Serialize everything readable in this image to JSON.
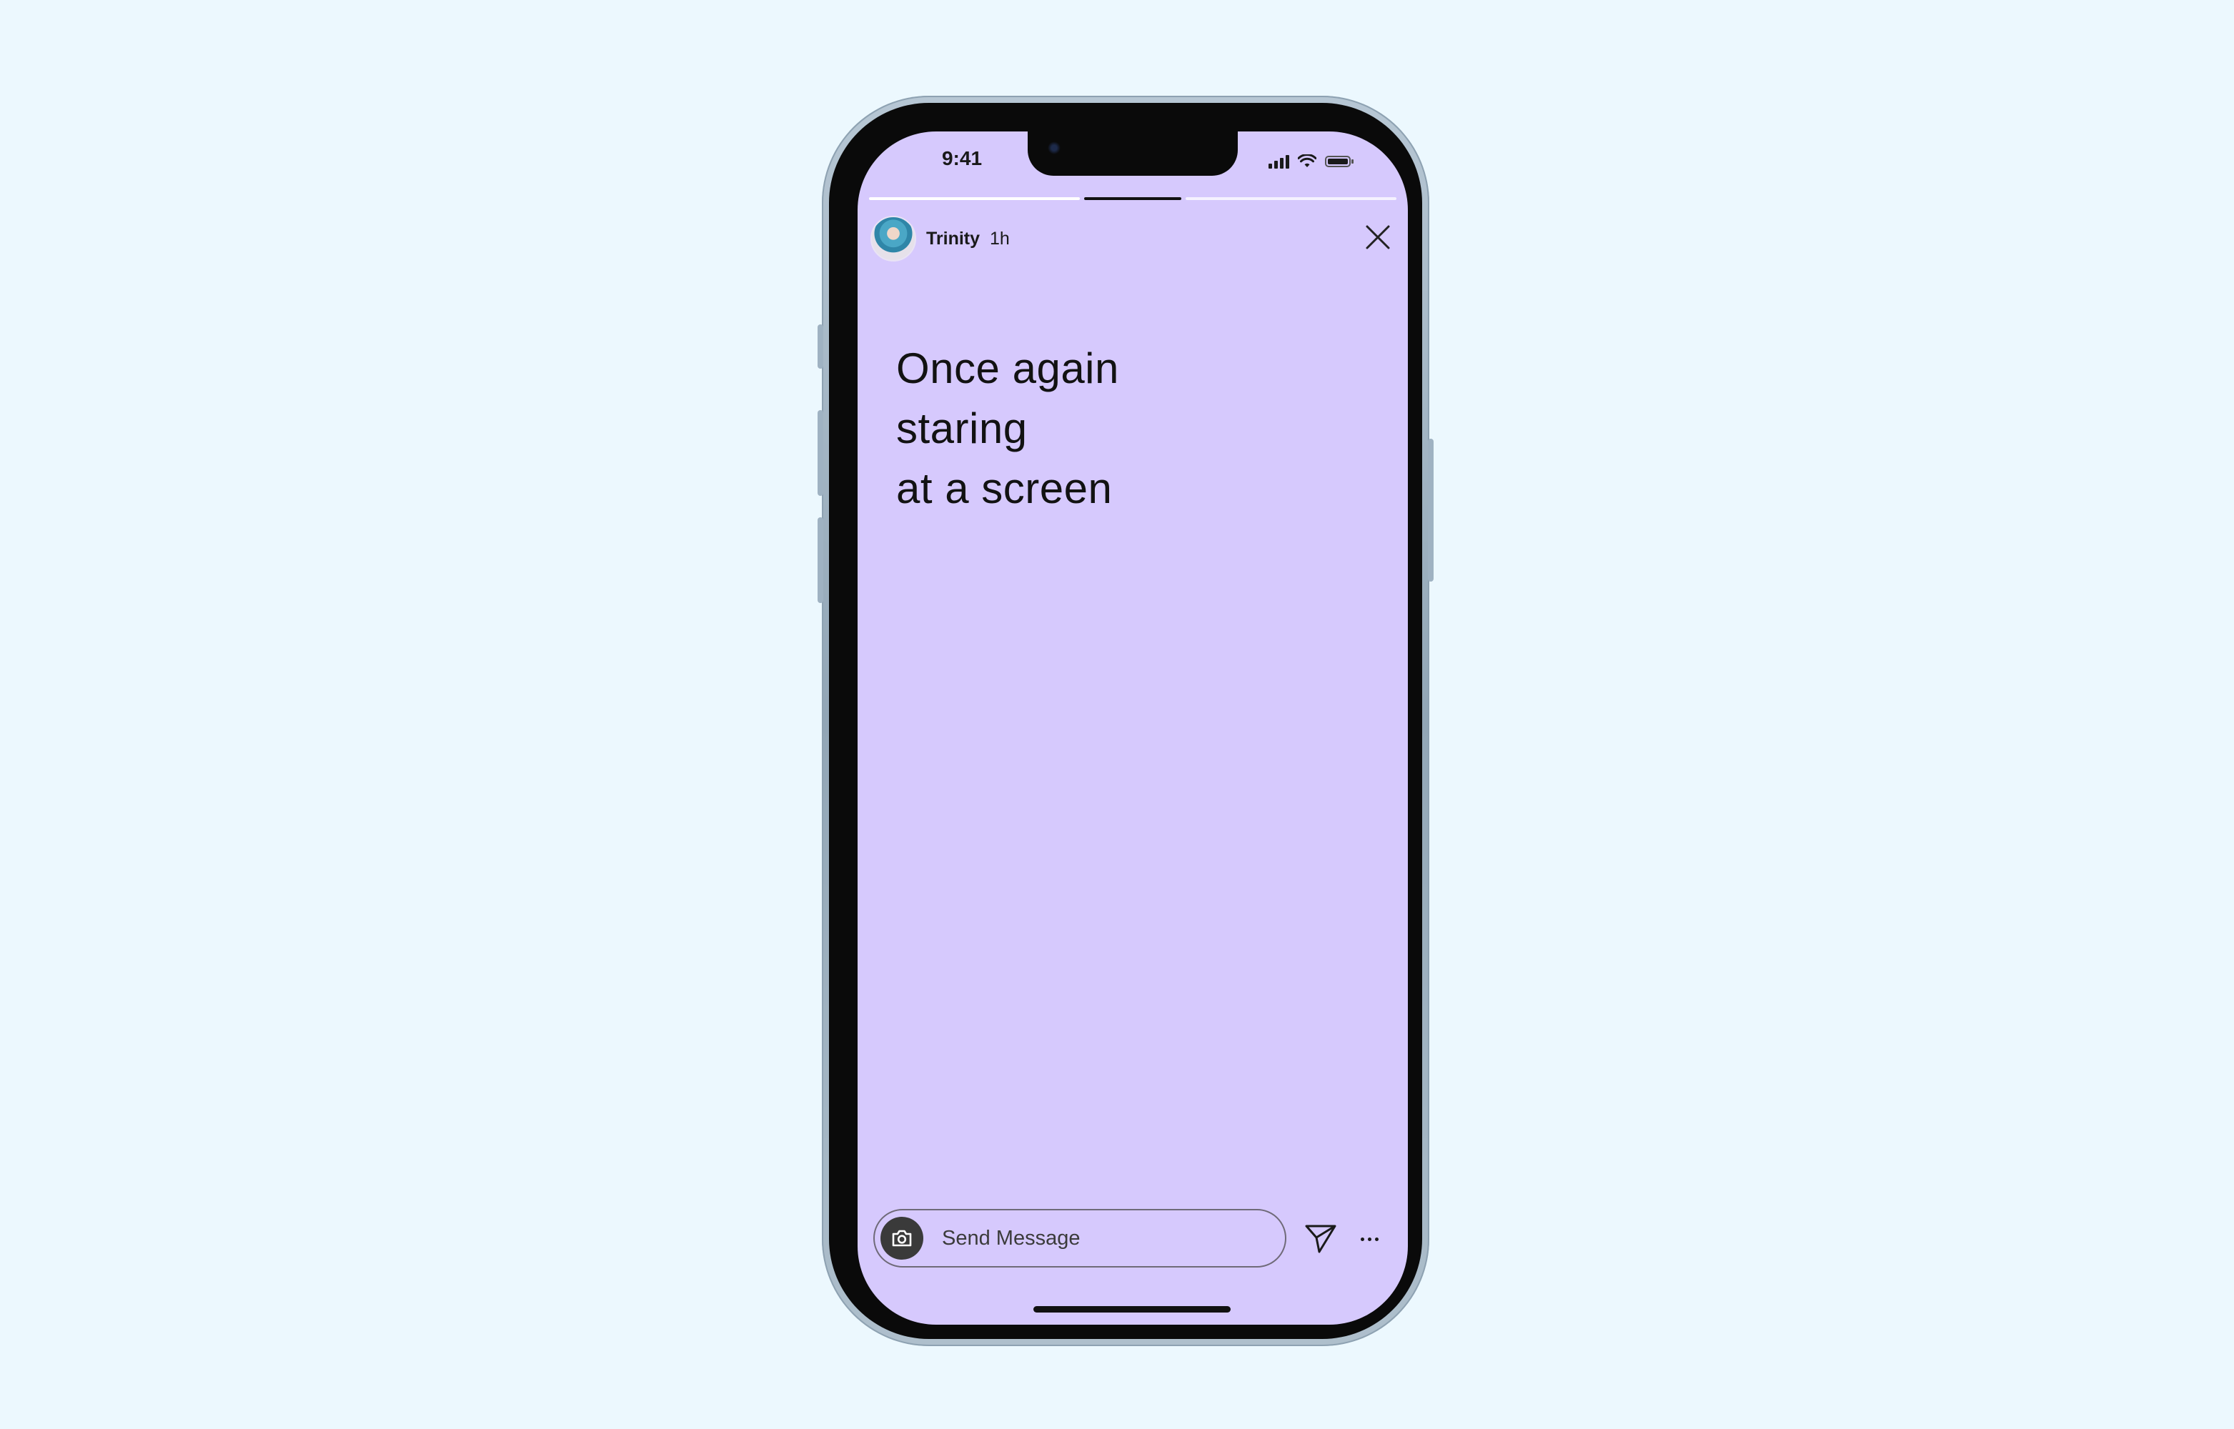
{
  "status_bar": {
    "time": "9:41",
    "icons": [
      "cellular-signal-icon",
      "wifi-icon",
      "battery-icon"
    ]
  },
  "story": {
    "segments_total": 3,
    "active_segment": 2,
    "active_progress": 1.0,
    "user": {
      "name": "Trinity",
      "time_ago": "1h",
      "avatar_icon": "user-avatar"
    },
    "text_lines": [
      "Once again",
      "staring",
      "at a screen"
    ],
    "background_color": "#d6c9fd"
  },
  "message_bar": {
    "placeholder": "Send Message",
    "camera_icon": "camera-icon",
    "send_icon": "send-icon",
    "more_icon": "more-icon"
  },
  "colors": {
    "page_background": "#ecf8fe",
    "text": "#121212"
  }
}
